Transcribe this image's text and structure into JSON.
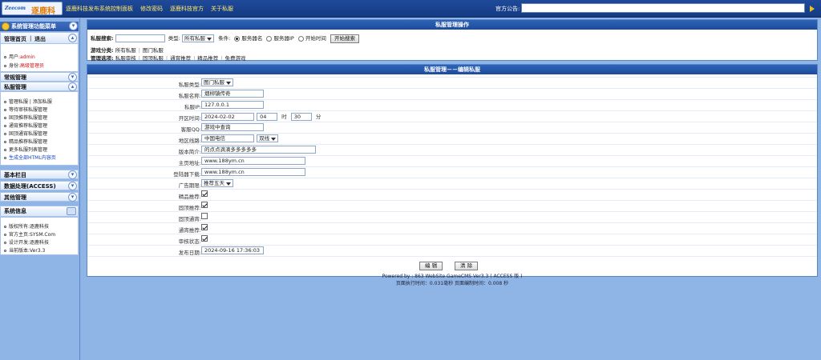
{
  "topbar": {
    "logo_en": "Zeecom",
    "logo_cn": "逐鹿科技",
    "nav": [
      "逐鹿科技发布系统控制面板",
      "修改密码",
      "逐鹿科技官方",
      "关于私服"
    ],
    "notice_label": "官方公告:",
    "notice_value": ""
  },
  "sidebar": {
    "header": "系统管理功能菜单",
    "home_label": "管理首页",
    "logout_label": "退出",
    "user_label": "用户:",
    "user_value": "admin",
    "role_label": "身份:",
    "role_value": "高级管理员",
    "common_title": "常规管理",
    "server_title": "私服管理",
    "server_items": [
      "管理私服",
      "添加私服",
      "等待审核私服管理",
      "固顶推荐私服管理",
      "通宵推荐私服管理",
      "固顶通宵私服管理",
      "精品推荐私服管理",
      "更多私服列表管理",
      "生成全部HTML内容页"
    ],
    "basic_title": "基本栏目",
    "data_title": "数据处理(ACCESS)",
    "other_title": "其他管理",
    "sysinfo_title": "系统信息",
    "sysinfo": [
      {
        "k": "版权所有:",
        "v": "逐鹿科技"
      },
      {
        "k": "官方主页:",
        "v": "SYSM.Com"
      },
      {
        "k": "设计开发:",
        "v": "逐鹿科技"
      },
      {
        "k": "当前版本:",
        "v": "Ver3.3"
      }
    ]
  },
  "ops": {
    "title": "私服管理操作",
    "search_label": "私服搜索:",
    "search_value": "",
    "type_label": "类型:",
    "type_value": "所有私服",
    "cond_label": "条件:",
    "radios": [
      "服务器名",
      "服务器IP",
      "开始时间"
    ],
    "search_btn": "开始搜索",
    "cat_label": "游戏分类:",
    "cats": [
      "所有私服",
      "图门私服"
    ],
    "mgmt_label": "管理选项:",
    "mgmt": [
      "私服审核",
      "固顶私服",
      "通宵推荐",
      "精品推荐",
      "免费游戏"
    ]
  },
  "edit": {
    "title": "私服管理－－编辑私服",
    "fields": {
      "type": {
        "label": "私服类型:",
        "value": "图门私服"
      },
      "name": {
        "label": "私服名称:",
        "value": "烟柳镇传奇"
      },
      "ip": {
        "label": "私服IP:",
        "value": "127.0.0.1"
      },
      "time": {
        "label": "开区时间:",
        "date": "2024-02-02",
        "hour": "04",
        "hour_unit": "时",
        "minute": "30",
        "minute_unit": "分"
      },
      "qq": {
        "label": "客服QQ:",
        "value": "游戏中查询"
      },
      "region": {
        "label": "地区线路:",
        "value": "中国电信",
        "line": "双线"
      },
      "intro": {
        "label": "版本简介:",
        "value": "的点点滴滴多多多多多"
      },
      "home": {
        "label": "主页地址:",
        "value": "www.188ym.cn"
      },
      "download": {
        "label": "登陆器下载:",
        "value": "www.188ym.cn"
      },
      "ad": {
        "label": "广告期限:",
        "value": "推荐五天"
      },
      "featured": {
        "label": "精品推荐:",
        "checked": true
      },
      "pinned": {
        "label": "固顶推荐:",
        "checked": true
      },
      "pinned_night": {
        "label": "固顶通宵:",
        "checked": false
      },
      "night": {
        "label": "通宵推荐:",
        "checked": true
      },
      "audit": {
        "label": "审核状态:",
        "checked": true
      },
      "publish": {
        "label": "发布日期:",
        "value": "2024-09-16 17:36:03"
      }
    },
    "edit_btn": "编 辑",
    "clear_btn": "清 除"
  },
  "footer": {
    "line1": "Powered by : 863 WebSite GameCMS Ver3.3 ( ACCESS 版 )",
    "line2": "页面执行时间：0.031毫秒    页面编制时间：0.008 秒"
  }
}
